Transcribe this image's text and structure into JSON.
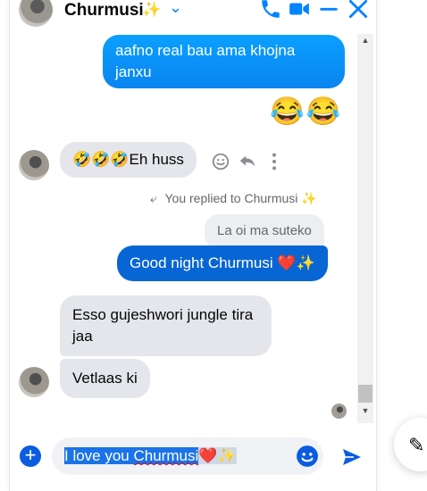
{
  "header": {
    "contact_name": "Churmusi",
    "name_emoji": "✨",
    "dropdown_icon": "chevron-down-icon",
    "actions": [
      "phone-icon",
      "video-icon",
      "minimize-icon",
      "close-icon"
    ]
  },
  "messages": {
    "outgoing_1": "aafno real bau ama khojna janxu",
    "outgoing_emojis": "😂😂",
    "incoming_1": "🤣🤣🤣Eh huss",
    "reply_note": "You replied to Churmusi",
    "reply_note_emoji": "✨",
    "quoted_message": "La oi ma suteko",
    "outgoing_2": "Good night Churmusi ❤️✨",
    "incoming_2": "Esso gujeshwori jungle tira jaa",
    "incoming_3": "Vetlaas ki"
  },
  "composer": {
    "text_part1": "I love you ",
    "text_part2": "Churmusi",
    "text_part3": "❤️",
    "text_part4": "✨"
  },
  "colors": {
    "brand": "#0084ff",
    "outgoing_bubble": "#0a8cf5",
    "incoming_bubble": "#e4e6eb",
    "selection": "#1a73e8"
  }
}
